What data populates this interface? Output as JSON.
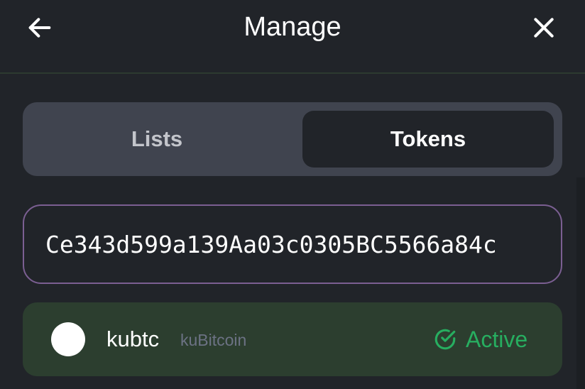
{
  "header": {
    "title": "Manage",
    "back_icon": "arrow-left-icon",
    "close_icon": "close-icon"
  },
  "tabs": [
    {
      "label": "Lists",
      "active": false
    },
    {
      "label": "Tokens",
      "active": true
    }
  ],
  "search": {
    "value": "Ce343d599a139Aa03c0305BC5566a84c",
    "border_color": "#7b5f92"
  },
  "token": {
    "symbol": "kubtc",
    "name": "kuBitcoin",
    "status": "Active",
    "status_icon": "check-circle-icon",
    "status_color": "#27ae60"
  }
}
